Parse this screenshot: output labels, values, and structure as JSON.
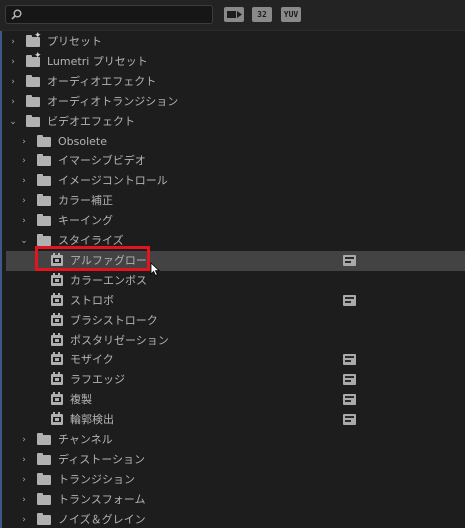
{
  "toolbar": {
    "search_value": "",
    "icons": [
      "search-icon",
      "accelerated-effects-icon",
      "32bit-effects-icon",
      "yuv-effects-icon"
    ],
    "btn_32_label": "32",
    "btn_yuv_label": "YUV"
  },
  "tree": [
    {
      "name": "presets",
      "label": "プリセット",
      "kind": "star-folder",
      "arrow": "collapsed"
    },
    {
      "name": "lumetri-presets",
      "label": "Lumetri プリセット",
      "kind": "star-folder",
      "arrow": "collapsed"
    },
    {
      "name": "audio-effects",
      "label": "オーディオエフェクト",
      "kind": "folder",
      "arrow": "collapsed"
    },
    {
      "name": "audio-transitions",
      "label": "オーディオトランジション",
      "kind": "folder",
      "arrow": "collapsed"
    },
    {
      "name": "video-effects",
      "label": "ビデオエフェクト",
      "kind": "folder",
      "arrow": "expanded"
    },
    {
      "name": "obsolete",
      "label": "Obsolete",
      "kind": "folder",
      "arrow": "collapsed"
    },
    {
      "name": "image-video",
      "label": "イマーシブビデオ",
      "kind": "folder",
      "arrow": "collapsed"
    },
    {
      "name": "image-control",
      "label": "イメージコントロール",
      "kind": "folder",
      "arrow": "collapsed"
    },
    {
      "name": "color-correction",
      "label": "カラー補正",
      "kind": "folder",
      "arrow": "collapsed"
    },
    {
      "name": "keying",
      "label": "キーイング",
      "kind": "folder",
      "arrow": "collapsed"
    },
    {
      "name": "stylize",
      "label": "スタイライズ",
      "kind": "folder",
      "arrow": "expanded"
    },
    {
      "name": "alpha-glow",
      "label": "アルファグロー",
      "kind": "effect",
      "badge": true,
      "selected": true
    },
    {
      "name": "color-emboss",
      "label": "カラーエンボス",
      "kind": "effect",
      "badge": false
    },
    {
      "name": "strobe",
      "label": "ストロボ",
      "kind": "effect",
      "badge": true
    },
    {
      "name": "brush-strokes",
      "label": "ブラシストローク",
      "kind": "effect",
      "badge": false
    },
    {
      "name": "posterization",
      "label": "ポスタリゼーション",
      "kind": "effect",
      "badge": false
    },
    {
      "name": "mosaic",
      "label": "モザイク",
      "kind": "effect",
      "badge": true
    },
    {
      "name": "rough-edges",
      "label": "ラフエッジ",
      "kind": "effect",
      "badge": true
    },
    {
      "name": "replicate",
      "label": "複製",
      "kind": "effect",
      "badge": true
    },
    {
      "name": "find-edges",
      "label": "輪郭検出",
      "kind": "effect",
      "badge": true
    },
    {
      "name": "channel",
      "label": "チャンネル",
      "kind": "folder",
      "arrow": "collapsed"
    },
    {
      "name": "distort",
      "label": "ディストーション",
      "kind": "folder",
      "arrow": "collapsed"
    },
    {
      "name": "transition",
      "label": "トランジション",
      "kind": "folder",
      "arrow": "collapsed"
    },
    {
      "name": "transform",
      "label": "トランスフォーム",
      "kind": "folder",
      "arrow": "collapsed"
    },
    {
      "name": "noise-grain",
      "label": "ノイズ＆グレイン",
      "kind": "folder",
      "arrow": "collapsed"
    }
  ],
  "colors": {
    "highlight": "#e2141e",
    "selected_row": "#434343",
    "background": "#1d1d1d"
  }
}
